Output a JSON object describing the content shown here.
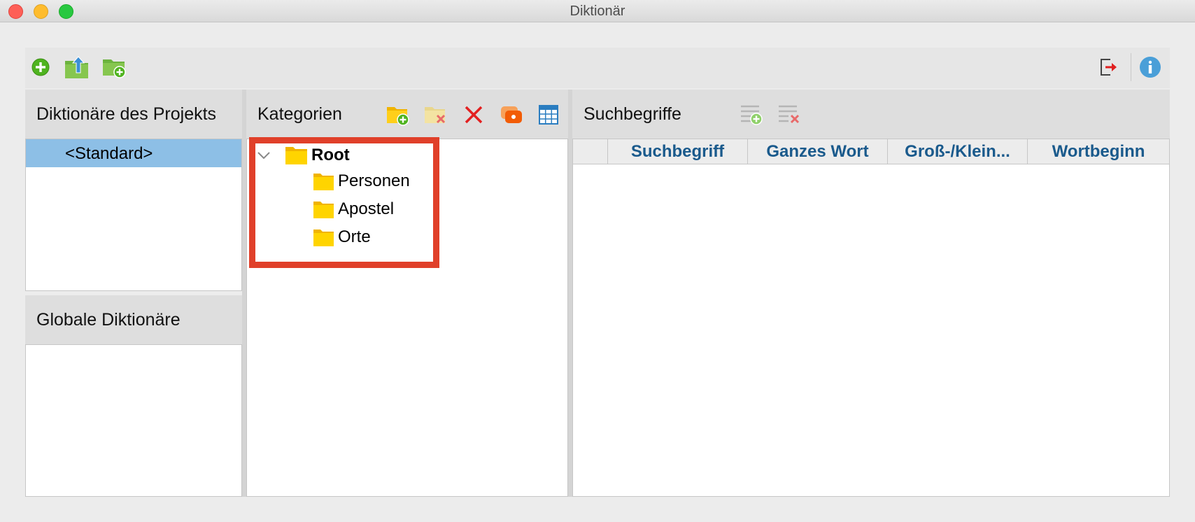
{
  "window": {
    "title": "Diktionär"
  },
  "toolbar": {
    "icons": [
      "add-dictionary-icon",
      "import-dictionary-icon",
      "add-folder-icon",
      "exit-icon",
      "info-icon"
    ]
  },
  "project_dictionaries": {
    "header": "Diktionäre des Projekts",
    "items": [
      {
        "label": "<Standard>",
        "selected": true
      }
    ]
  },
  "global_dictionaries": {
    "header": "Globale Diktionäre",
    "items": []
  },
  "categories": {
    "header": "Kategorien",
    "tools": [
      "new-category-icon",
      "delete-category-icon",
      "delete-icon",
      "merge-icon",
      "table-icon"
    ],
    "tree": {
      "root": {
        "label": "Root",
        "expanded": true
      },
      "children": [
        {
          "label": "Personen"
        },
        {
          "label": "Apostel"
        },
        {
          "label": "Orte"
        }
      ]
    },
    "highlight_color": "#e0402a"
  },
  "search_terms": {
    "header": "Suchbegriffe",
    "tools": [
      "add-search-term-icon",
      "delete-search-term-icon"
    ],
    "columns": [
      "Suchbegriff",
      "Ganzes Wort",
      "Groß-/Klein...",
      "Wortbeginn"
    ],
    "rows": []
  },
  "colors": {
    "selection": "#8dbfe6",
    "column_header_text": "#1a5a8c",
    "folder": "#ffd400",
    "accent_green": "#5bb52c"
  }
}
